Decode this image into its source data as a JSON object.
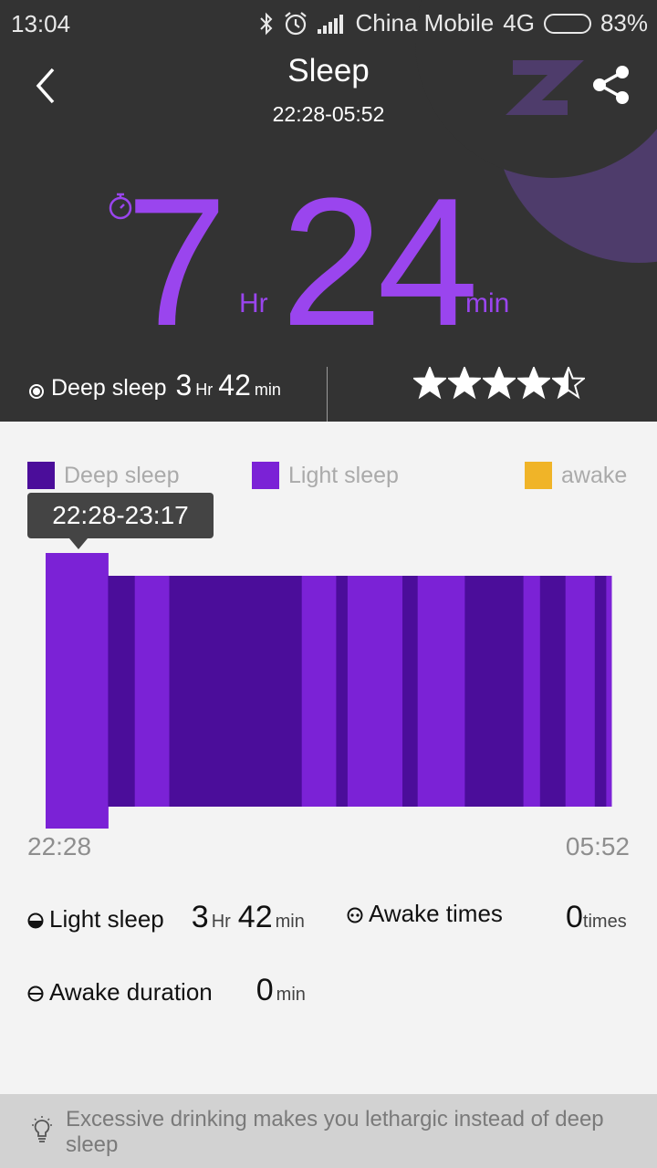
{
  "status_bar": {
    "time": "13:04",
    "carrier": "China Mobile",
    "network": "4G",
    "battery_percent": "83%",
    "battery_level": 0.83
  },
  "header": {
    "title": "Sleep",
    "time_range": "22:28-05:52"
  },
  "total": {
    "hours": "7",
    "hours_unit": "Hr",
    "minutes": "24",
    "minutes_unit": "min"
  },
  "deep_sleep": {
    "label": "Deep sleep",
    "hours": "3",
    "hours_unit": "Hr",
    "minutes": "42",
    "minutes_unit": "min"
  },
  "rating": {
    "stars": 4.5,
    "max": 5
  },
  "legend": [
    {
      "label": "Deep sleep",
      "color": "#4b0d9a"
    },
    {
      "label": "Light sleep",
      "color": "#7b22d6"
    },
    {
      "label": "awake",
      "color": "#f0b428"
    }
  ],
  "tooltip": {
    "text": "22:28-23:17"
  },
  "chart_data": {
    "type": "bar",
    "start_label": "22:28",
    "end_label": "05:52",
    "segments": [
      {
        "from": "22:28",
        "to": "23:17",
        "stage": "light",
        "selected": true
      },
      {
        "from": "23:17",
        "to": "23:38",
        "stage": "deep"
      },
      {
        "from": "23:38",
        "to": "24:05",
        "stage": "light"
      },
      {
        "from": "24:05",
        "to": "25:49",
        "stage": "deep"
      },
      {
        "from": "25:49",
        "to": "26:16",
        "stage": "light"
      },
      {
        "from": "26:16",
        "to": "26:25",
        "stage": "deep"
      },
      {
        "from": "26:25",
        "to": "27:08",
        "stage": "light"
      },
      {
        "from": "27:08",
        "to": "27:20",
        "stage": "deep"
      },
      {
        "from": "27:20",
        "to": "27:57",
        "stage": "light"
      },
      {
        "from": "27:57",
        "to": "28:43",
        "stage": "deep"
      },
      {
        "from": "28:43",
        "to": "28:56",
        "stage": "light"
      },
      {
        "from": "28:56",
        "to": "29:16",
        "stage": "deep"
      },
      {
        "from": "29:16",
        "to": "29:39",
        "stage": "light"
      },
      {
        "from": "29:39",
        "to": "29:48",
        "stage": "deep"
      },
      {
        "from": "29:48",
        "to": "29:52",
        "stage": "light"
      }
    ]
  },
  "stats": {
    "light_sleep": {
      "label": "Light sleep",
      "hours": "3",
      "hours_unit": "Hr",
      "minutes": "42",
      "minutes_unit": "min"
    },
    "awake_times": {
      "label": "Awake times",
      "value": "0",
      "unit": "times"
    },
    "awake_duration": {
      "label": "Awake duration",
      "value": "0",
      "unit": "min"
    }
  },
  "tip": {
    "text": "Excessive drinking makes you lethargic instead of deep sleep"
  }
}
